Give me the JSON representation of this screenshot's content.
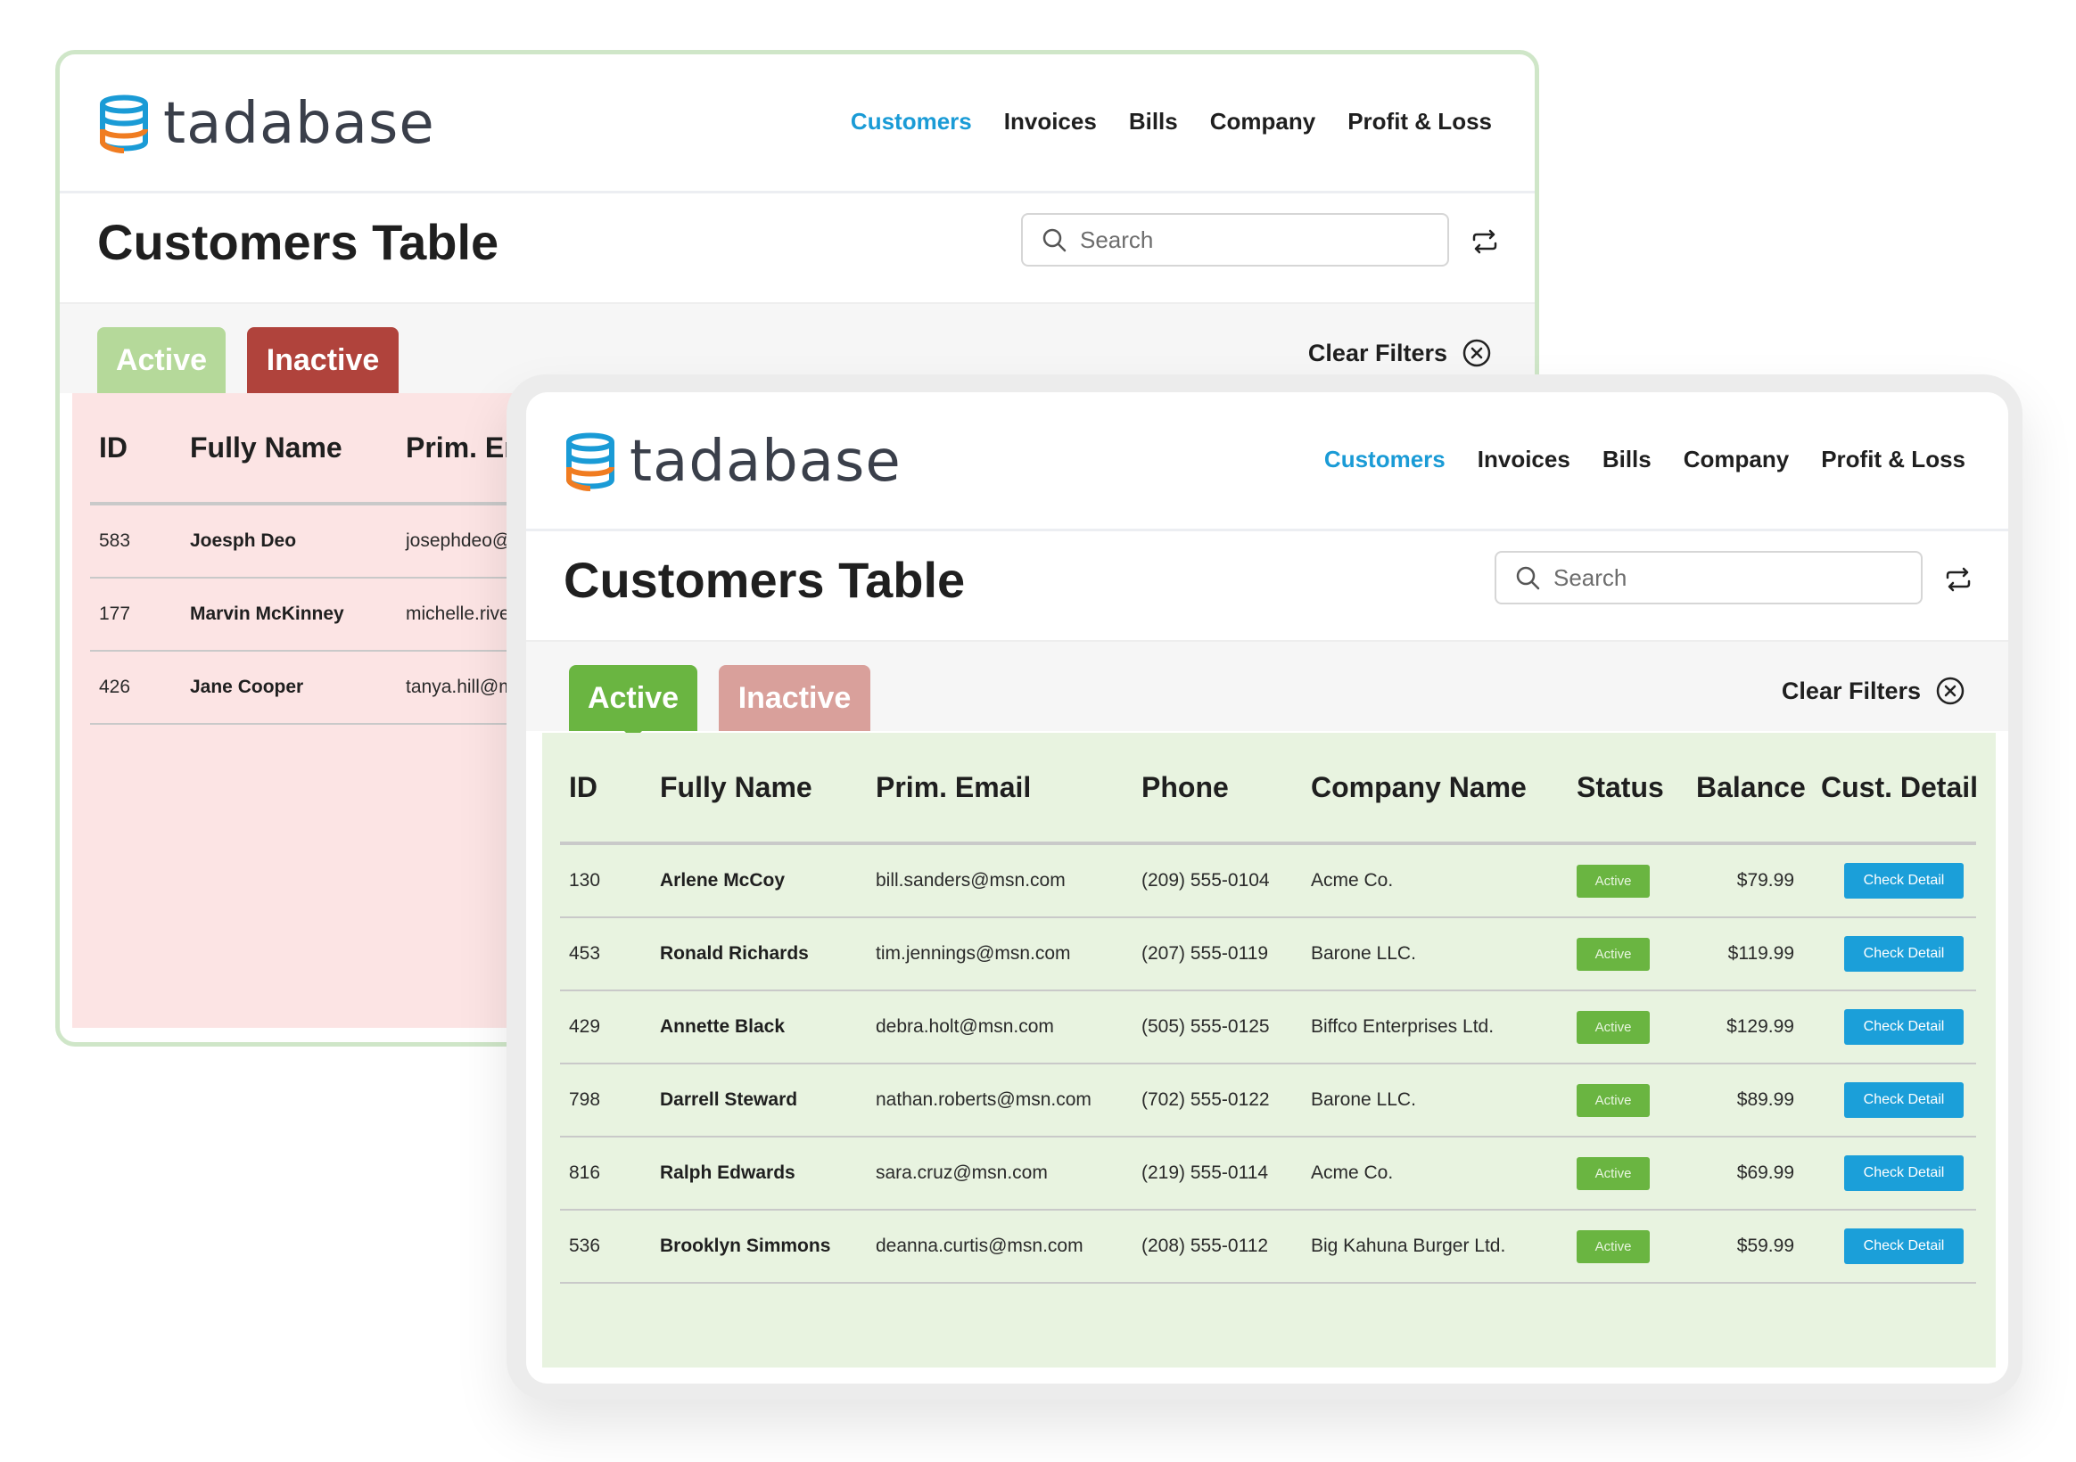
{
  "app": {
    "brand": "tadabase",
    "nav": [
      "Customers",
      "Invoices",
      "Bills",
      "Company",
      "Profit & Loss"
    ],
    "active_nav": "Customers",
    "page_title": "Customers Table",
    "search_placeholder": "Search",
    "tabs": {
      "active": "Active",
      "inactive": "Inactive"
    },
    "clear_filters": "Clear Filters"
  },
  "colors": {
    "accent_blue": "#1a9bd6",
    "active_green": "#6ab541",
    "inactive_red": "#b0433c",
    "inactive_bg": "#fce4e4",
    "active_bg": "#e8f3e0"
  },
  "back_table": {
    "columns": [
      "ID",
      "Fully Name",
      "Prim. Email"
    ],
    "rows": [
      {
        "id": "583",
        "name": "Joesph Deo",
        "email": "josephdeo@ex"
      },
      {
        "id": "177",
        "name": "Marvin McKinney",
        "email": "michelle.rivera("
      },
      {
        "id": "426",
        "name": "Jane Cooper",
        "email": "tanya.hill@msn"
      }
    ]
  },
  "front_table": {
    "columns": [
      "ID",
      "Fully Name",
      "Prim. Email",
      "Phone",
      "Company Name",
      "Status",
      "Balance",
      "Cust. Details"
    ],
    "rows": [
      {
        "id": "130",
        "name": "Arlene McCoy",
        "email": "bill.sanders@msn.com",
        "phone": "(209) 555-0104",
        "company": "Acme Co.",
        "status": "Active",
        "balance": "$79.99",
        "action": "Check Detail"
      },
      {
        "id": "453",
        "name": "Ronald Richards",
        "email": "tim.jennings@msn.com",
        "phone": "(207) 555-0119",
        "company": "Barone LLC.",
        "status": "Active",
        "balance": "$119.99",
        "action": "Check Detail"
      },
      {
        "id": "429",
        "name": "Annette Black",
        "email": "debra.holt@msn.com",
        "phone": "(505) 555-0125",
        "company": "Biffco Enterprises Ltd.",
        "status": "Active",
        "balance": "$129.99",
        "action": "Check Detail"
      },
      {
        "id": "798",
        "name": "Darrell Steward",
        "email": "nathan.roberts@msn.com",
        "phone": "(702) 555-0122",
        "company": "Barone LLC.",
        "status": "Active",
        "balance": "$89.99",
        "action": "Check Detail"
      },
      {
        "id": "816",
        "name": "Ralph Edwards",
        "email": "sara.cruz@msn.com",
        "phone": "(219) 555-0114",
        "company": "Acme Co.",
        "status": "Active",
        "balance": "$69.99",
        "action": "Check Detail"
      },
      {
        "id": "536",
        "name": "Brooklyn Simmons",
        "email": "deanna.curtis@msn.com",
        "phone": "(208) 555-0112",
        "company": "Big Kahuna Burger Ltd.",
        "status": "Active",
        "balance": "$59.99",
        "action": "Check Detail"
      }
    ]
  }
}
